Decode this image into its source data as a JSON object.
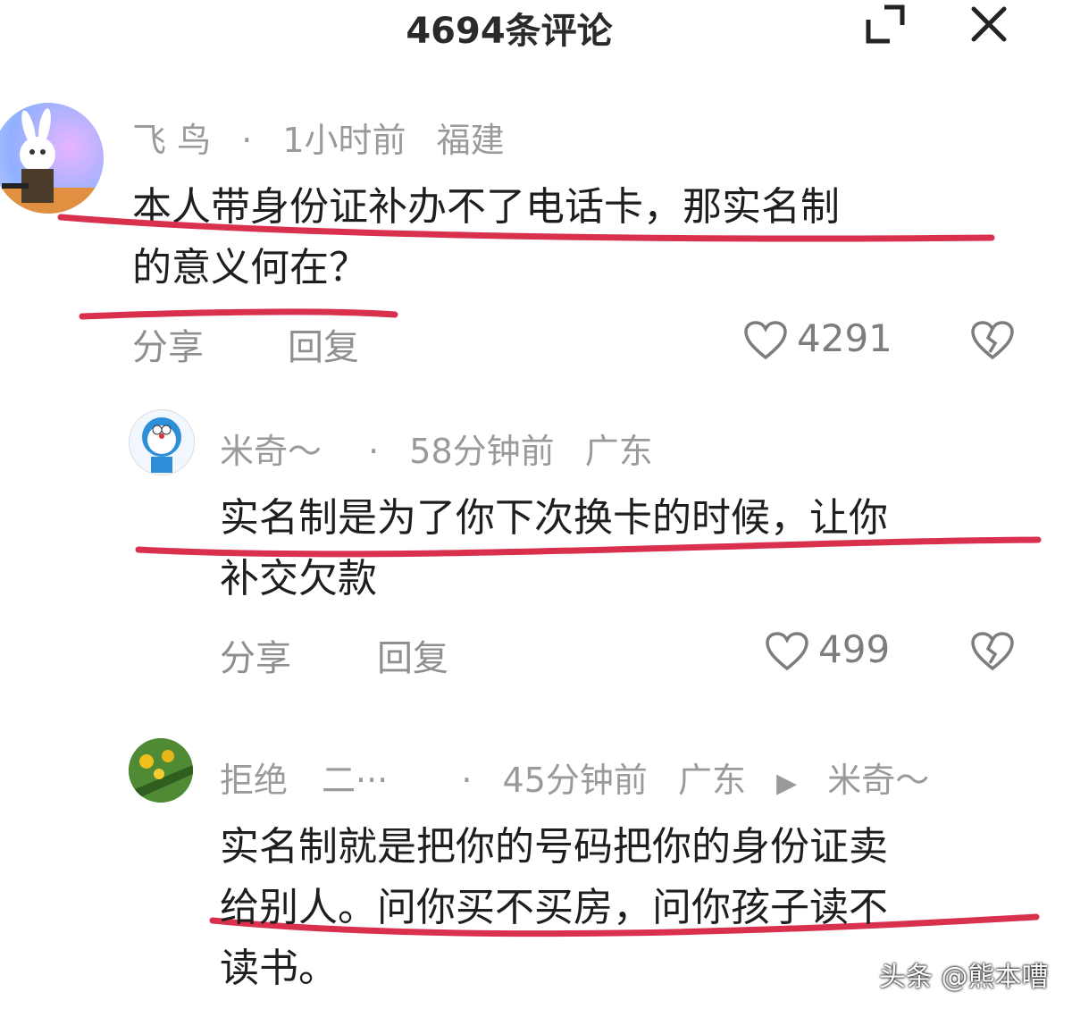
{
  "header": {
    "title": "4694条评论",
    "expand_icon": "expand-icon",
    "close_icon": "close-icon"
  },
  "comments": [
    {
      "username": "飞 鸟",
      "dot": "·",
      "time": "1小时前",
      "location": "福建",
      "text_lines": [
        "本人带身份证补办不了电话卡，那实名制",
        "的意义何在？"
      ],
      "share": "分享",
      "reply": "回复",
      "likes": "4291",
      "avatar_icon": "rabbit-avatar"
    },
    {
      "username": "米奇～",
      "dot": "·",
      "time": "58分钟前",
      "location": "广东",
      "text_lines": [
        "实名制是为了你下次换卡的时候，让你",
        "补交欠款"
      ],
      "share": "分享",
      "reply": "回复",
      "likes": "499",
      "avatar_icon": "doraemon-avatar"
    },
    {
      "username": "拒绝　二···",
      "dot": "·",
      "time": "45分钟前",
      "location": "广东",
      "reply_to_arrow": "▶",
      "reply_to": "米奇～",
      "text_lines": [
        "实名制就是把你的号码把你的身份证卖",
        "给别人。问你买不买房，问你孩子读不",
        "读书。"
      ],
      "avatar_icon": "flower-avatar"
    }
  ],
  "watermark": "头条 @熊本嘈",
  "colors": {
    "underline": "#d9304d",
    "meta_gray": "#9a9a9a"
  }
}
